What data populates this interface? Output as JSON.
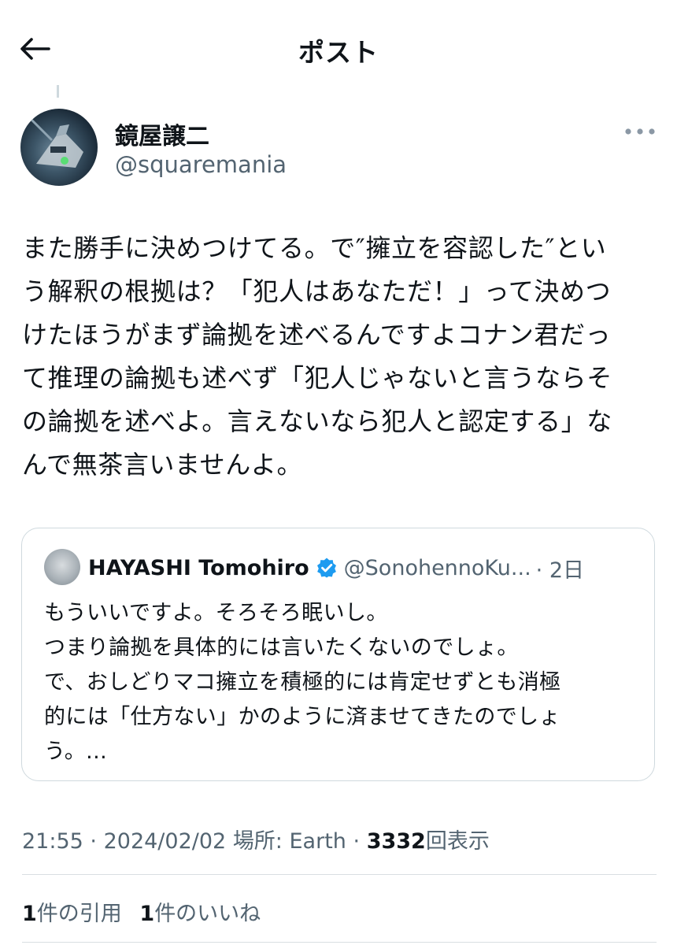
{
  "header": {
    "title": "ポスト",
    "back_icon": "arrow-left-icon"
  },
  "post": {
    "author_name": "鏡屋譲二",
    "author_handle": "@squaremania",
    "text": "また勝手に決めつけてる。で″擁立を容認した″とい\nう解釈の根拠は？「犯人はあなただ！」って決めつ\nけたほうがまず論拠を述べるんですよコナン君だっ\nて推理の論拠も述べず「犯人じゃないと言うならそ\nの論拠を述べよ。言えないなら犯人と認定する」な\nんで無茶言いませんよ。",
    "more_icon": "more-horizontal-icon"
  },
  "quote": {
    "author_name": "HAYASHI Tomohiro",
    "verified_icon": "verified-badge-icon",
    "handle": "@SonohennoKu...",
    "time": "· 2日",
    "text": "もういいですよ。そろそろ眠いし。\nつまり論拠を具体的には言いたくないのでしょ。\nで、おしどりマコ擁立を積極的には肯定せずとも消極\n的には「仕方ない」かのように済ませてきたのでしょ\nう。..."
  },
  "meta": {
    "time": "21:55",
    "date": "2024/02/02",
    "location": "場所: Earth",
    "views_count": "3332",
    "views_label": "回表示",
    "separator": "·"
  },
  "stats": {
    "quotes_count": "1",
    "quotes_label": "件の引用",
    "likes_count": "1",
    "likes_label": "件のいいね"
  },
  "colors": {
    "text": "#0f1419",
    "secondary": "#536471",
    "border": "#cfd9de",
    "verified": "#1d9bf0"
  }
}
